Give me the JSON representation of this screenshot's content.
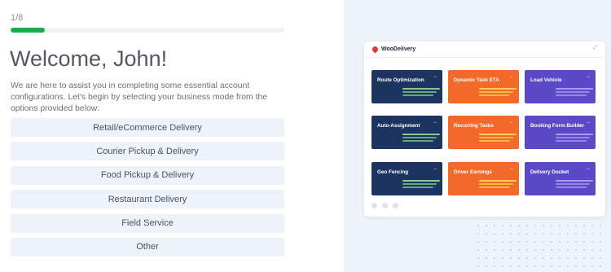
{
  "onboarding": {
    "step": "1/8",
    "progress_fraction": 0.125,
    "title": "Welcome, John!",
    "intro": "We are here to assist you in completing some essential account configurations. Let's begin by selecting your business mode from the options provided below:",
    "options": [
      "Retail/eCommerce Delivery",
      "Courier Pickup & Delivery",
      "Food Pickup & Delivery",
      "Restaurant Delivery",
      "Field Service",
      "Other"
    ]
  },
  "preview": {
    "app_name": "WooDelivery",
    "expand_icon": "expand-icon",
    "tiles": [
      {
        "label": "Route Optimization",
        "color": "#1d3461",
        "bars": "#7fcf8a"
      },
      {
        "label": "Dynamic Task ETA",
        "color": "#f2692a",
        "bars": "#ffd24a"
      },
      {
        "label": "Load Vehicle",
        "color": "#5b49c8",
        "bars": "#a99bf0"
      },
      {
        "label": "Auto-Assignment",
        "color": "#1d3461",
        "bars": "#7fcf8a"
      },
      {
        "label": "Recurring Tasks",
        "color": "#f2692a",
        "bars": "#ffd24a"
      },
      {
        "label": "Booking Form Builder",
        "color": "#5b49c8",
        "bars": "#a99bf0"
      },
      {
        "label": "Geo Fencing",
        "color": "#1d3461",
        "bars": "#7fcf8a"
      },
      {
        "label": "Driver Earnings",
        "color": "#f2692a",
        "bars": "#ffd24a"
      },
      {
        "label": "Delivery Docket",
        "color": "#5b49c8",
        "bars": "#a99bf0"
      }
    ]
  },
  "colors": {
    "progress": "#1fa84f",
    "option_bg": "#eef3fb",
    "panel_bg": "#eef3fb"
  }
}
